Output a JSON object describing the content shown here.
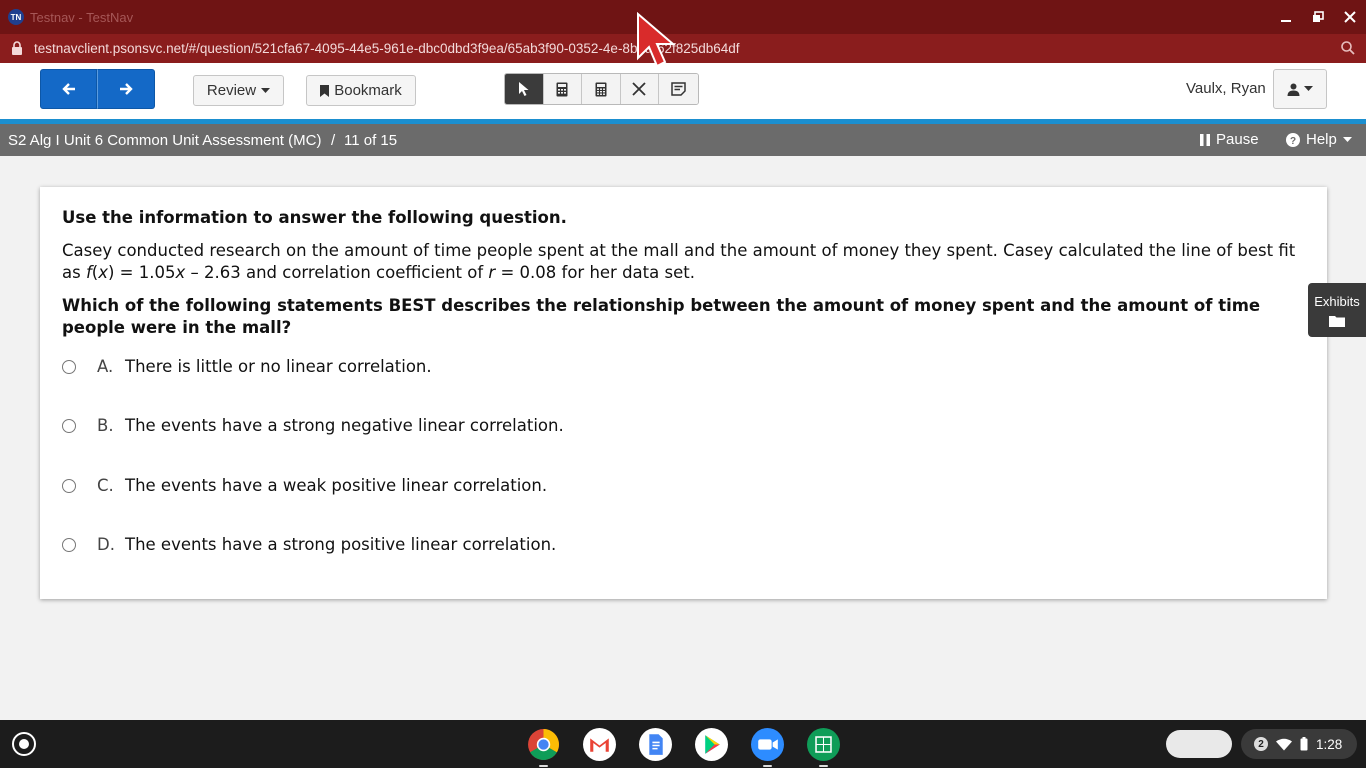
{
  "window": {
    "badge": "TN",
    "title": "Testnav - TestNav"
  },
  "address_bar": {
    "url": "testnavclient.psonsvc.net/#/question/521cfa67-4095-44e5-961e-dbc0dbd3f9ea/65ab3f90-0352-4e-8b0a-62f825db64df"
  },
  "toolbar": {
    "review_label": "Review",
    "bookmark_label": "Bookmark",
    "tools": [
      "pointer-icon",
      "calculator-icon",
      "scientific-calculator-icon",
      "answer-eliminator-icon",
      "notepad-icon"
    ],
    "user_name": "Vaulx, Ryan"
  },
  "test_bar": {
    "test_name": "S2 Alg I Unit 6 Common Unit Assessment (MC)",
    "separator": "/",
    "progress": "11 of 15",
    "pause_label": "Pause",
    "help_label": "Help"
  },
  "question": {
    "intro": "Use the information to answer the following question.",
    "body_part1": "Casey conducted research on the amount of time people spent at the mall and the amount of money they spent. Casey calculated the line of best fit as ",
    "func_f": "f",
    "func_arg": "x",
    "func_rest": " = 1.05",
    "func_x": "x",
    "func_end": " – 2.63 and correlation coefficient of ",
    "r_var": "r",
    "body_part2": " = 0.08 for her data set.",
    "prompt": "Which of the following statements BEST describes the relationship between the amount of money spent and the amount of time people were in the mall?",
    "options": [
      {
        "letter": "A.",
        "text": "There is little or no linear correlation."
      },
      {
        "letter": "B.",
        "text": "The events have a strong negative linear correlation."
      },
      {
        "letter": "C.",
        "text": "The events have a weak positive linear correlation."
      },
      {
        "letter": "D.",
        "text": "The events have a strong positive linear correlation."
      }
    ]
  },
  "exhibits": {
    "label": "Exhibits"
  },
  "taskbar": {
    "apps": [
      "chrome-icon",
      "gmail-icon",
      "docs-icon",
      "play-store-icon",
      "zoom-icon",
      "sheets-icon"
    ],
    "notification_count": "2",
    "time": "1:28"
  }
}
